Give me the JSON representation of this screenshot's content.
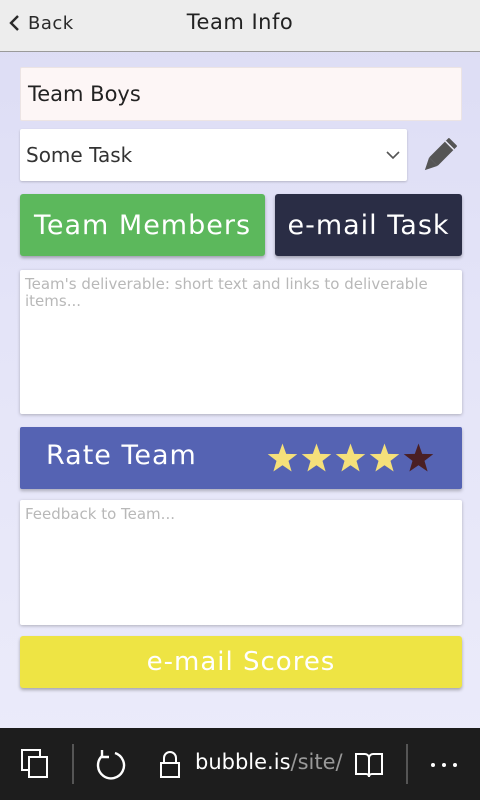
{
  "header": {
    "back_label": "Back",
    "title": "Team Info"
  },
  "form": {
    "team_name_value": "Team Boys",
    "task_select_value": "Some Task",
    "deliverable_placeholder": "Team's deliverable: short text and links to deliverable items...",
    "feedback_placeholder": "Feedback to Team..."
  },
  "buttons": {
    "team_members_label": "Team Members",
    "email_task_label": "e-mail Task",
    "email_scores_label": "e-mail Scores"
  },
  "rating": {
    "label": "Rate Team",
    "value": 4,
    "max": 5,
    "filled_color": "#f5e07a",
    "empty_color": "#4a1f24"
  },
  "browser": {
    "url_host": "bubble.is",
    "url_path": "/site/"
  },
  "colors": {
    "members_button": "#5cb85c",
    "email_task_button": "#2a2d45",
    "rate_bar": "#5563b3",
    "email_scores_button": "#eee444"
  }
}
